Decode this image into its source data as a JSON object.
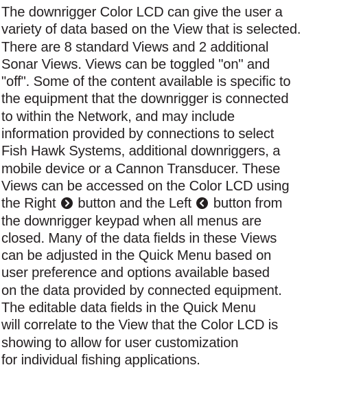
{
  "paragraph": {
    "lines": [
      "The downrigger Color LCD can give the user a",
      "variety of data based on the View that is selected.",
      "There are 8 standard Views and 2 additional",
      "Sonar Views. Views can be toggled \"on\" and",
      "\"off\". Some of the content available is specific to",
      "the equipment that the downrigger is connected",
      "to within the Network, and may include",
      "information provided by connections to select",
      "Fish Hawk Systems, additional downriggers, a",
      "mobile device or a Cannon Transducer. These",
      "Views can be accessed on the Color LCD using"
    ],
    "line12": {
      "before": "the Right",
      "middle": "button and the Left",
      "after": "button from"
    },
    "lines_after": [
      "the downrigger keypad when all menus are",
      "closed. Many of the data fields in these Views",
      "can be adjusted in the Quick Menu based on",
      "user preference and options available based",
      "on the data provided by connected equipment.",
      "The editable data fields in the Quick Menu",
      "will correlate to the View that the Color LCD is",
      "showing to allow for user customization",
      "for individual fishing applications."
    ]
  },
  "icons": {
    "right": "chevron-right-icon",
    "left": "chevron-left-icon",
    "color": "#231f20"
  }
}
